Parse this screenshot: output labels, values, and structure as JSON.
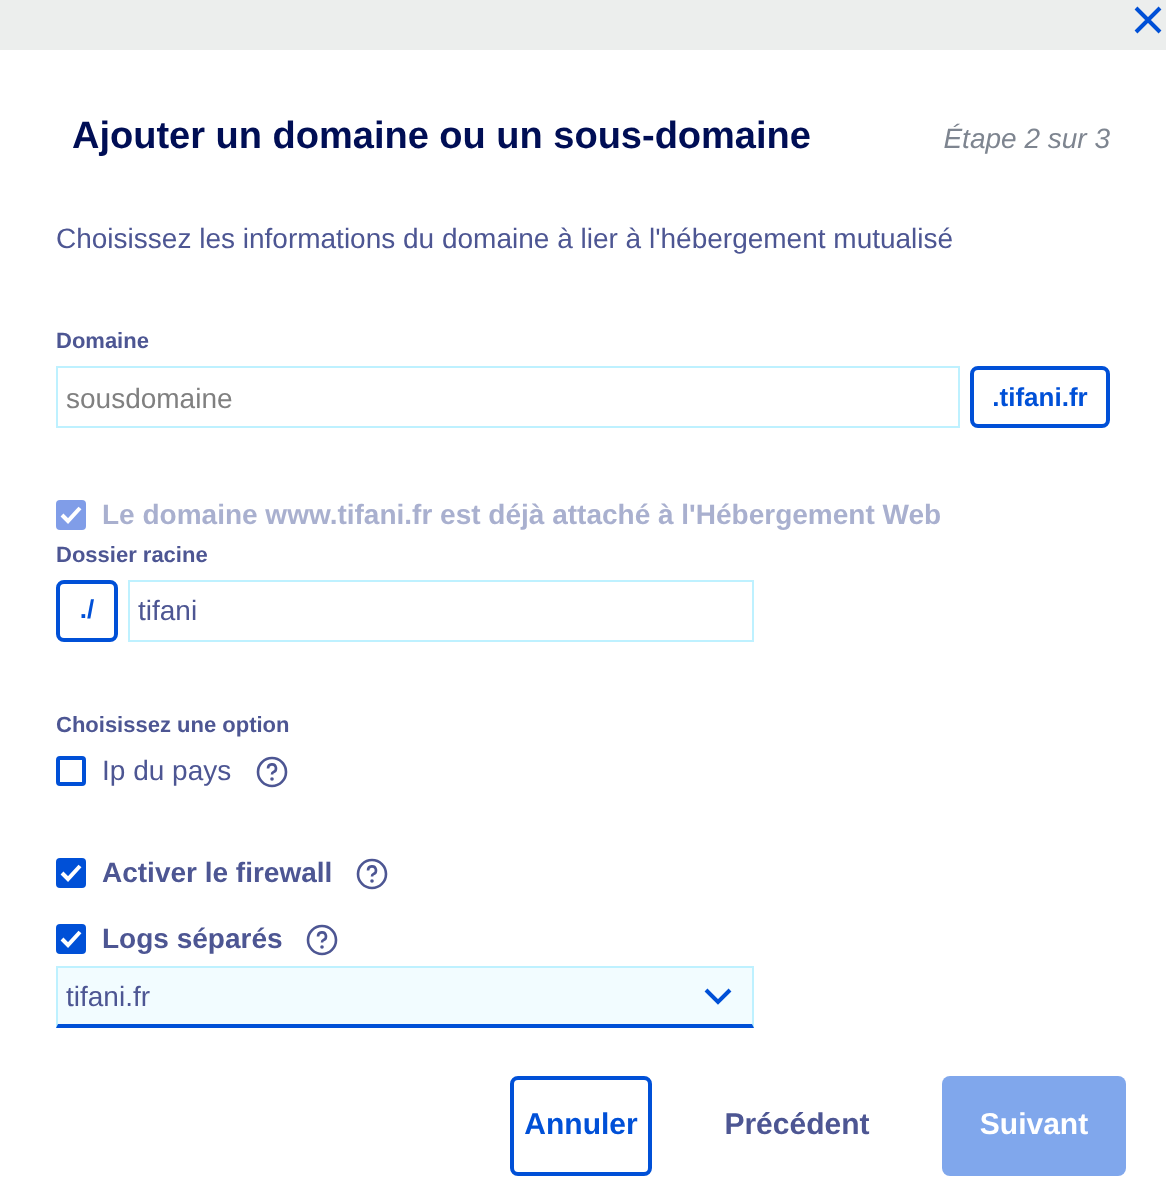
{
  "title": "Ajouter un domaine ou un sous-domaine",
  "step": "Étape 2 sur 3",
  "subtitle": "Choisissez les informations du domaine à lier à l'hébergement mutualisé",
  "domain": {
    "label": "Domaine",
    "placeholder": "sousdomaine",
    "suffix": ".tifani.fr"
  },
  "attached": {
    "label": "Le domaine www.tifani.fr est déjà attaché à l'Hébergement Web",
    "checked": true,
    "disabled": true
  },
  "root_folder": {
    "label": "Dossier racine",
    "prefix": "./",
    "value": "tifani"
  },
  "option": {
    "label": "Choisissez une option",
    "items": [
      {
        "label": "Ip du pays",
        "checked": false,
        "bold": false
      }
    ]
  },
  "options": [
    {
      "label": "Activer le firewall",
      "checked": true,
      "bold": true
    },
    {
      "label": "Logs séparés",
      "checked": true,
      "bold": true
    }
  ],
  "logs_select": {
    "value": "tifani.fr"
  },
  "buttons": [
    {
      "label": "Annuler",
      "kind": "outline"
    },
    {
      "label": "Précédent",
      "kind": "text"
    },
    {
      "label": "Suivant",
      "kind": "primary",
      "disabled": true
    }
  ]
}
